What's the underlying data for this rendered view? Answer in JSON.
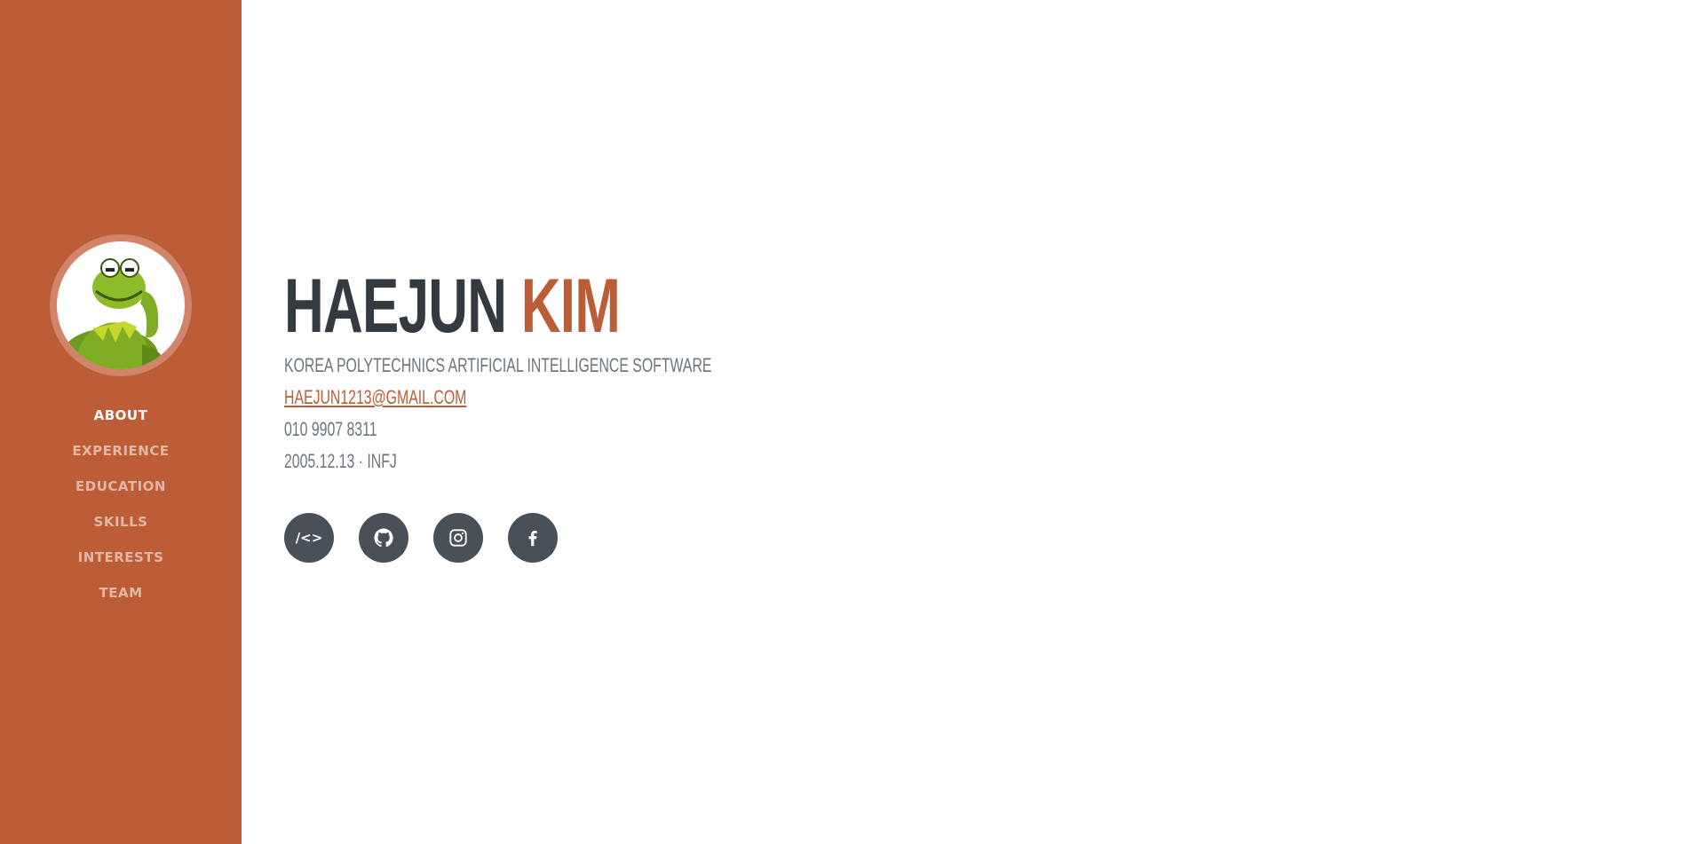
{
  "colors": {
    "sidebar_bg": "#bd5d38",
    "accent": "#bd5d38",
    "heading": "#343a40",
    "text_muted": "#6c757d",
    "social_bg": "#495057"
  },
  "sidebar": {
    "avatar_alt": "kermit-frog-avatar",
    "nav": [
      {
        "label": "ABOUT",
        "active": true
      },
      {
        "label": "EXPERIENCE",
        "active": false
      },
      {
        "label": "EDUCATION",
        "active": false
      },
      {
        "label": "SKILLS",
        "active": false
      },
      {
        "label": "INTERESTS",
        "active": false
      },
      {
        "label": "TEAM",
        "active": false
      }
    ]
  },
  "about": {
    "first_name": "HAEJUN",
    "last_name": "KIM",
    "school": "KOREA POLYTECHNICS ARTIFICIAL INTELLIGENCE SOFTWARE",
    "email": "HAEJUN1213@GMAIL.COM",
    "phone": "010 9907 8311",
    "birth_mbti": "2005.12.13 · INFJ"
  },
  "socials": [
    {
      "name": "code-icon",
      "text": "/<>"
    },
    {
      "name": "github-icon"
    },
    {
      "name": "instagram-icon"
    },
    {
      "name": "facebook-icon"
    }
  ]
}
